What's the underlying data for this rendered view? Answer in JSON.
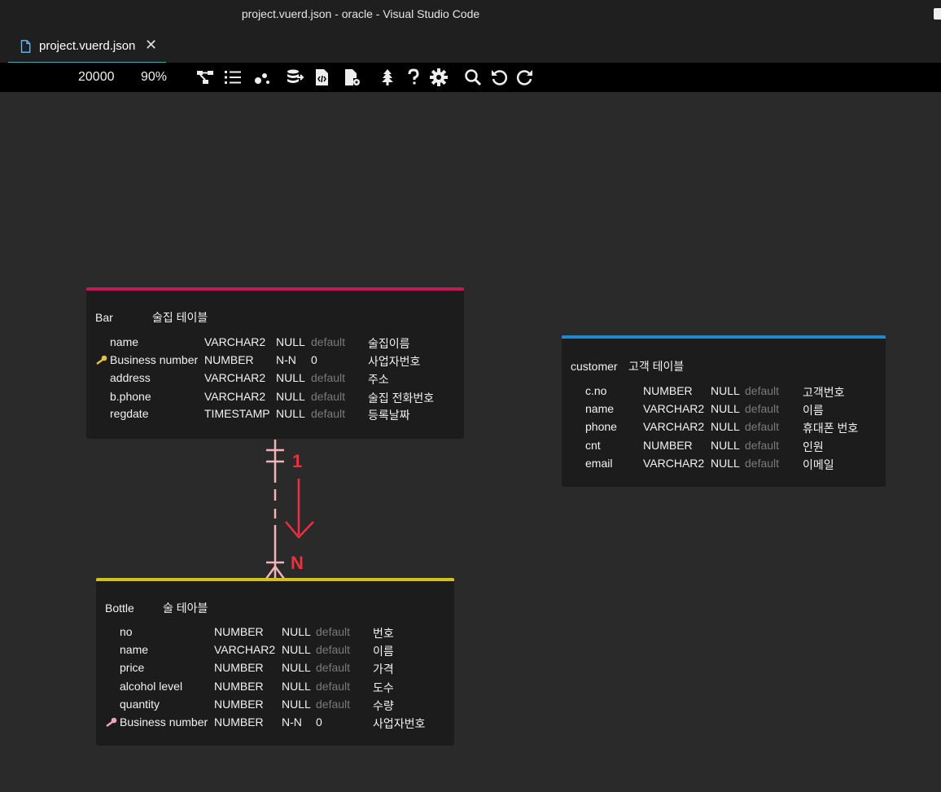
{
  "window": {
    "title": "project.vuerd.json - oracle - Visual Studio Code"
  },
  "tab": {
    "label": "project.vuerd.json",
    "close": "✕"
  },
  "toolbar": {
    "width": "20000",
    "zoom": "90%",
    "icons": [
      "relationship-icon",
      "list-icon",
      "visualization-icon",
      "database-export-icon",
      "code-file-icon",
      "file-settings-icon",
      "tree-icon",
      "help-icon",
      "settings-icon",
      "search-icon",
      "undo-icon",
      "redo-icon"
    ]
  },
  "colors": {
    "bar": "#c2185b",
    "bottle": "#d4c120",
    "customer": "#1e8ad6",
    "relation": "#e8323c",
    "relation_line": "#f3b3bb"
  },
  "tables": {
    "bar": {
      "name": "Bar",
      "comment": "술집 테이블",
      "columns": [
        {
          "name": "name",
          "type": "VARCHAR2",
          "nullable": "NULL",
          "default": "default",
          "comment": "술집이름",
          "pk": false
        },
        {
          "name": "Business number",
          "type": "NUMBER",
          "nullable": "N-N",
          "default": "0",
          "comment": "사업자번호",
          "pk": true
        },
        {
          "name": "address",
          "type": "VARCHAR2",
          "nullable": "NULL",
          "default": "default",
          "comment": "주소",
          "pk": false
        },
        {
          "name": "b.phone",
          "type": "VARCHAR2",
          "nullable": "NULL",
          "default": "default",
          "comment": "술집 전화번호",
          "pk": false
        },
        {
          "name": "regdate",
          "type": "TIMESTAMP",
          "nullable": "NULL",
          "default": "default",
          "comment": "등록날짜",
          "pk": false
        }
      ]
    },
    "customer": {
      "name": "customer",
      "comment": "고객 테이블",
      "columns": [
        {
          "name": "c.no",
          "type": "NUMBER",
          "nullable": "NULL",
          "default": "default",
          "comment": "고객번호",
          "pk": false
        },
        {
          "name": "name",
          "type": "VARCHAR2",
          "nullable": "NULL",
          "default": "default",
          "comment": "이름",
          "pk": false
        },
        {
          "name": "phone",
          "type": "VARCHAR2",
          "nullable": "NULL",
          "default": "default",
          "comment": "휴대폰 번호",
          "pk": false
        },
        {
          "name": "cnt",
          "type": "NUMBER",
          "nullable": "NULL",
          "default": "default",
          "comment": "인원",
          "pk": false
        },
        {
          "name": "email",
          "type": "VARCHAR2",
          "nullable": "NULL",
          "default": "default",
          "comment": "이메일",
          "pk": false
        }
      ]
    },
    "bottle": {
      "name": "Bottle",
      "comment": "술 테아블",
      "columns": [
        {
          "name": "no",
          "type": "NUMBER",
          "nullable": "NULL",
          "default": "default",
          "comment": "번호",
          "pk": false
        },
        {
          "name": "name",
          "type": "VARCHAR2",
          "nullable": "NULL",
          "default": "default",
          "comment": "이름",
          "pk": false
        },
        {
          "name": "price",
          "type": "NUMBER",
          "nullable": "NULL",
          "default": "default",
          "comment": "가격",
          "pk": false
        },
        {
          "name": "alcohol level",
          "type": "NUMBER",
          "nullable": "NULL",
          "default": "default",
          "comment": "도수",
          "pk": false
        },
        {
          "name": "quantity",
          "type": "NUMBER",
          "nullable": "NULL",
          "default": "default",
          "comment": "수량",
          "pk": false
        },
        {
          "name": "Business number",
          "type": "NUMBER",
          "nullable": "N-N",
          "default": "0",
          "comment": "사업자번호",
          "pk": true
        }
      ]
    }
  },
  "relationship": {
    "one": "1",
    "many": "N"
  }
}
